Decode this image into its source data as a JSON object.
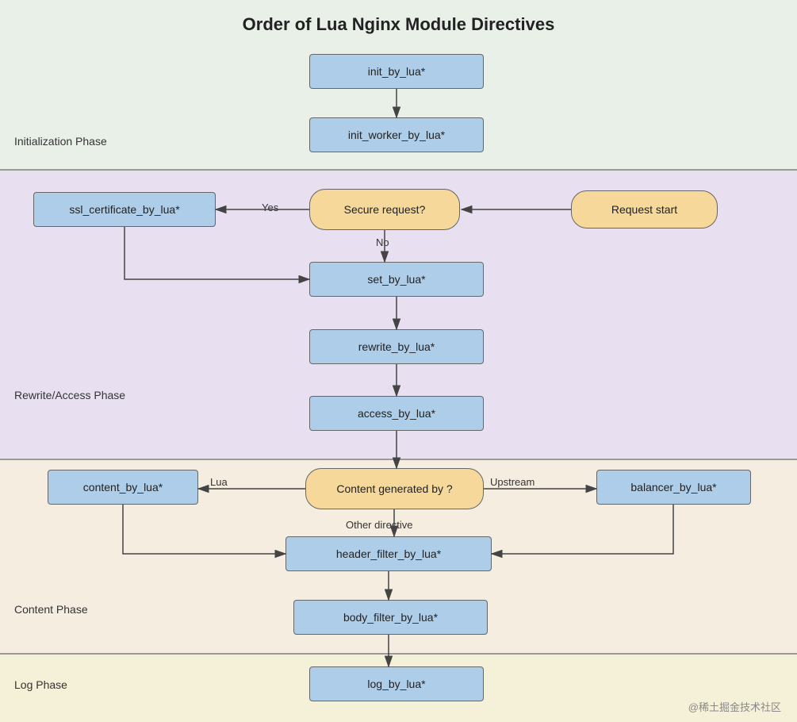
{
  "title": "Order of Lua Nginx Module Directives",
  "phases": {
    "init": {
      "label": "Initialization Phase"
    },
    "rewrite": {
      "label": "Rewrite/Access Phase"
    },
    "content": {
      "label": "Content Phase"
    },
    "log": {
      "label": "Log Phase"
    }
  },
  "boxes": {
    "init_by_lua": "init_by_lua*",
    "init_worker_by_lua": "init_worker_by_lua*",
    "ssl_certificate_by_lua": "ssl_certificate_by_lua*",
    "secure_request": "Secure request?",
    "request_start": "Request start",
    "set_by_lua": "set_by_lua*",
    "rewrite_by_lua": "rewrite_by_lua*",
    "access_by_lua": "access_by_lua*",
    "content_generated_by": "Content generated by ?",
    "content_by_lua": "content_by_lua*",
    "balancer_by_lua": "balancer_by_lua*",
    "header_filter_by_lua": "header_filter_by_lua*",
    "body_filter_by_lua": "body_filter_by_lua*",
    "log_by_lua": "log_by_lua*"
  },
  "arrow_labels": {
    "yes": "Yes",
    "no": "No",
    "lua": "Lua",
    "upstream": "Upstream",
    "other_directive": "Other directive"
  },
  "watermark": "@稀土掘金技术社区"
}
